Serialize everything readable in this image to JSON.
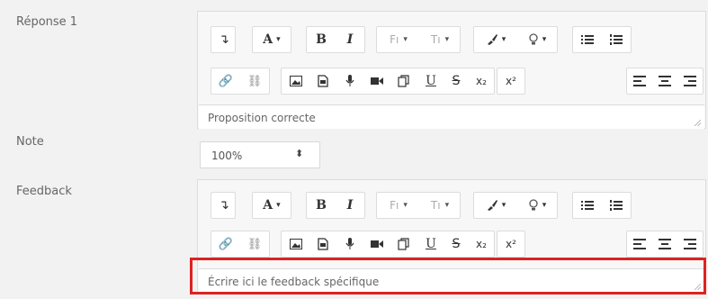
{
  "labels": {
    "reponse": "Réponse 1",
    "note": "Note",
    "feedback": "Feedback"
  },
  "toolbar": {
    "undo": "↴",
    "font_color": "A",
    "bold": "B",
    "italic": "I",
    "font": "Fı",
    "text_size": "Tı",
    "underline": "U",
    "strike": "S",
    "subscript": "x₂",
    "superscript": "x²",
    "caret": "▾"
  },
  "editor1": {
    "text": "Proposition correcte"
  },
  "note_select": {
    "value": "100%",
    "arrows": "⬍"
  },
  "editor2": {
    "placeholder": "Écrire ici le feedback spécifique"
  },
  "colors": {
    "highlight": "#dd2222",
    "background": "#f2f2f2"
  }
}
